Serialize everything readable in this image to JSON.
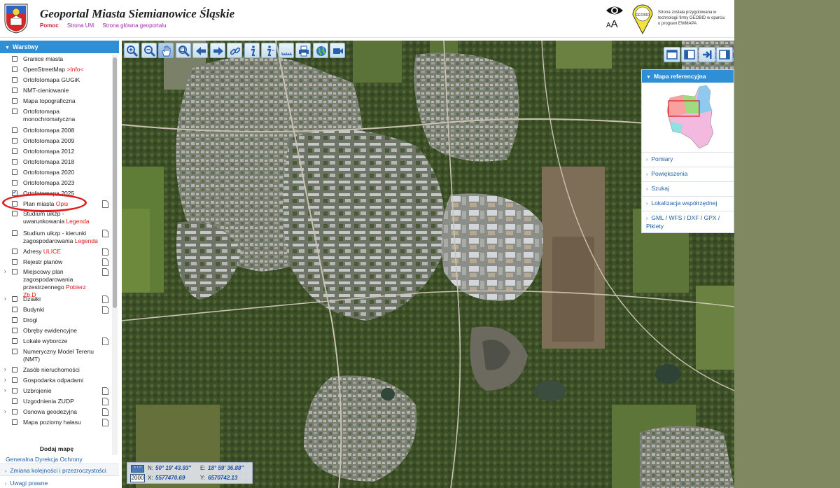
{
  "header": {
    "title": "Geoportal Miasta Siemianowice Śląskie",
    "links": [
      "Pomoc",
      "Strona UM",
      "Strona główna geoportalu"
    ],
    "aa_label": "AA",
    "geobid_note": "Strona została przygotowana w technologii firmy GEOBID w oparciu o program EWMAPA",
    "geobid_logo_text": "GEOBID"
  },
  "left_panel": {
    "header": "Warstwy",
    "layers": [
      {
        "label": "Granice miasta",
        "checked": false,
        "expandable": false,
        "doc": false
      },
      {
        "label": "OpenStreetMap",
        "extra": ">Info<",
        "checked": false,
        "expandable": false,
        "doc": false
      },
      {
        "label": "Ortofotomapa GUGiK",
        "checked": false,
        "expandable": false,
        "doc": false
      },
      {
        "label": "NMT-cieniowanie",
        "checked": false,
        "expandable": false,
        "doc": false
      },
      {
        "label": "Mapa topograficzna",
        "checked": false,
        "expandable": false,
        "doc": false
      },
      {
        "label": "Ortofotomapa monochromatyczna",
        "checked": false,
        "expandable": false,
        "doc": false
      },
      {
        "label": "Ortofotomapa 2008",
        "checked": false,
        "expandable": false,
        "doc": false
      },
      {
        "label": "Ortofotomapa 2009",
        "checked": false,
        "expandable": false,
        "doc": false
      },
      {
        "label": "Ortofotomapa 2012",
        "checked": false,
        "expandable": false,
        "doc": false
      },
      {
        "label": "Ortofotomapa 2018",
        "checked": false,
        "expandable": false,
        "doc": false
      },
      {
        "label": "Ortofotomapa 2020",
        "checked": false,
        "expandable": false,
        "doc": false
      },
      {
        "label": "Ortofotomapa 2023",
        "checked": false,
        "expandable": false,
        "doc": false
      },
      {
        "label": "Ortofotomapa 2025",
        "checked": true,
        "expandable": false,
        "doc": false
      },
      {
        "label": "Plan miasta",
        "extra": "Opis",
        "checked": false,
        "expandable": false,
        "doc": true
      },
      {
        "label": "Studium uikzp - uwarunkowania",
        "extra": "Legenda",
        "checked": false,
        "expandable": false,
        "doc": false
      },
      {
        "label": "Studium uikzp - kierunki zagospodarowania",
        "extra": "Legenda",
        "checked": false,
        "expandable": false,
        "doc": true
      },
      {
        "label": "Adresy",
        "extra": "ULICE",
        "checked": false,
        "expandable": false,
        "doc": true
      },
      {
        "label": "Rejestr planów",
        "checked": false,
        "expandable": false,
        "doc": true
      },
      {
        "label": "Miejscowy plan zagospodarowania przestrzennego",
        "extra": "Pobierz Zb.D",
        "checked": false,
        "expandable": true,
        "doc": true
      },
      {
        "label": "Działki",
        "checked": false,
        "expandable": true,
        "doc": true
      },
      {
        "label": "Budynki",
        "checked": false,
        "expandable": false,
        "doc": true
      },
      {
        "label": "Drogi",
        "checked": false,
        "expandable": false,
        "doc": false
      },
      {
        "label": "Obręby ewidencyjne",
        "checked": false,
        "expandable": false,
        "doc": false
      },
      {
        "label": "Lokale wyborcze",
        "checked": false,
        "expandable": false,
        "doc": true
      },
      {
        "label": "Numeryczny Model Terenu (NMT)",
        "checked": false,
        "expandable": false,
        "doc": false
      },
      {
        "label": "Zasób nieruchomości",
        "checked": false,
        "expandable": true,
        "doc": false
      },
      {
        "label": "Gospodarka odpadami",
        "checked": false,
        "expandable": true,
        "doc": false
      },
      {
        "label": "Uzbrojenie",
        "checked": false,
        "expandable": true,
        "doc": true
      },
      {
        "label": "Uzgodnienia ZUDP",
        "checked": false,
        "expandable": false,
        "doc": true
      },
      {
        "label": "Osnowa geodezyjna",
        "checked": false,
        "expandable": true,
        "doc": true
      },
      {
        "label": "Mapa poziomy hałasu",
        "checked": false,
        "expandable": false,
        "doc": true
      }
    ],
    "add_map": "Dodaj mapę",
    "gdos_link": "Generalna Dyrekcja Ochrony",
    "order_link": "Zmiana kolejności i przezroczystości",
    "remarks_link": "Uwagi prawne"
  },
  "toolbar": {
    "icons": [
      "zoom-in-icon",
      "zoom-out-icon",
      "pan-hand-icon",
      "zoom-extent-icon",
      "back-arrow-icon",
      "forward-arrow-icon",
      "link-icon",
      "info-icon",
      "info-query-icon",
      "measure-ruler-icon",
      "print-icon",
      "globe-icon",
      "camera-icon"
    ]
  },
  "view_buttons": [
    "layout-full-icon",
    "layout-left-icon",
    "export-arrow-icon",
    "layout-right-icon"
  ],
  "right_panel": {
    "header": "Mapa referencyjna",
    "items": [
      "Pomiary",
      "Powiększenia",
      "Szukaj",
      "Lokalizacja współrzędnej",
      "GML / WFS / DXF / GPX / Pikiety"
    ]
  },
  "coords": {
    "icon_label": "° ' \"",
    "year": "2000",
    "n_label": "N:",
    "n_value": "50° 19' 43.93\"",
    "e_label": "E:",
    "e_value": "18° 59' 36.88\"",
    "x_label": "X:",
    "x_value": "5577470.69",
    "y_label": "Y:",
    "y_value": "6570742.13"
  },
  "colors": {
    "accent_blue": "#2f8fd6",
    "link_blue": "#1e5fa8",
    "highlight_red": "#e01e1e",
    "right_background": "#7f8860"
  }
}
